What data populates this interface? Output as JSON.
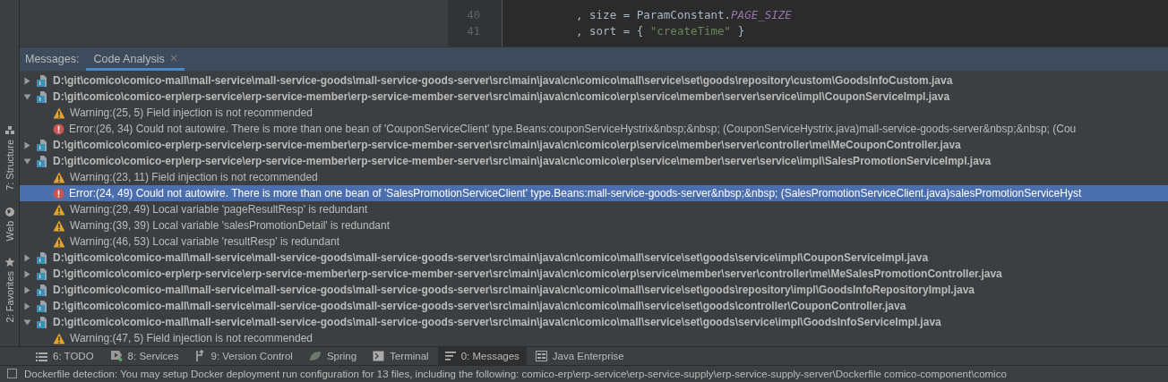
{
  "side_strip": [
    {
      "label": "7: Structure"
    },
    {
      "label": "Web"
    },
    {
      "label": "2: Favorites"
    }
  ],
  "editor": {
    "lines": [
      {
        "number": "40",
        "code": [
          {
            "kind": "plain",
            "text": ", size = ParamConstant."
          },
          {
            "kind": "constant",
            "text": "PAGE_SIZE"
          }
        ]
      },
      {
        "number": "41",
        "code": [
          {
            "kind": "plain",
            "text": ", sort = { "
          },
          {
            "kind": "string",
            "text": "\"createTime\""
          },
          {
            "kind": "plain",
            "text": " }"
          }
        ]
      }
    ]
  },
  "messages": {
    "label": "Messages:",
    "tabs": [
      {
        "label": "Code Analysis",
        "selected": true
      }
    ],
    "tree": [
      {
        "kind": "file",
        "text": "D:\\git\\comico\\comico-mall\\mall-service\\mall-service-goods\\mall-service-goods-server\\src\\main\\java\\cn\\comico\\mall\\service\\set\\goods\\repository\\custom\\GoodsInfoCustom.java",
        "expanded": false,
        "selected": false
      },
      {
        "kind": "file",
        "text": "D:\\git\\comico\\comico-erp\\erp-service\\erp-service-member\\erp-service-member-server\\src\\main\\java\\cn\\comico\\erp\\service\\member\\server\\service\\impl\\CouponServiceImpl.java",
        "expanded": true,
        "selected": false,
        "children": [
          {
            "kind": "warning",
            "text": "Warning:(25, 5)  Field injection is not recommended",
            "selected": false
          },
          {
            "kind": "error",
            "text": "Error:(26, 34)  Could not autowire. There is more than one bean of 'CouponServiceClient' type.Beans:couponServiceHystrix&nbsp;&nbsp; (CouponServiceHystrix.java)mall-service-goods-server&nbsp;&nbsp; (Cou",
            "selected": false
          }
        ]
      },
      {
        "kind": "file",
        "text": "D:\\git\\comico\\comico-erp\\erp-service\\erp-service-member\\erp-service-member-server\\src\\main\\java\\cn\\comico\\erp\\service\\member\\server\\controller\\me\\MeCouponController.java",
        "expanded": false,
        "selected": false
      },
      {
        "kind": "file",
        "text": "D:\\git\\comico\\comico-erp\\erp-service\\erp-service-member\\erp-service-member-server\\src\\main\\java\\cn\\comico\\erp\\service\\member\\server\\service\\impl\\SalesPromotionServiceImpl.java",
        "expanded": true,
        "selected": false,
        "children": [
          {
            "kind": "warning",
            "text": "Warning:(23, 11)  Field injection is not recommended",
            "selected": false
          },
          {
            "kind": "error",
            "text": "Error:(24, 49)  Could not autowire. There is more than one bean of 'SalesPromotionServiceClient' type.Beans:mall-service-goods-server&nbsp;&nbsp; (SalesPromotionServiceClient.java)salesPromotionServiceHyst",
            "selected": true
          },
          {
            "kind": "warning",
            "text": "Warning:(29, 49)  Local variable 'pageResultResp' is redundant",
            "selected": false
          },
          {
            "kind": "warning",
            "text": "Warning:(39, 39)  Local variable 'salesPromotionDetail' is redundant",
            "selected": false
          },
          {
            "kind": "warning",
            "text": "Warning:(46, 53)  Local variable 'resultResp' is redundant",
            "selected": false
          }
        ]
      },
      {
        "kind": "file",
        "text": "D:\\git\\comico\\comico-mall\\mall-service\\mall-service-goods\\mall-service-goods-server\\src\\main\\java\\cn\\comico\\mall\\service\\set\\goods\\service\\impl\\CouponServiceImpl.java",
        "expanded": false,
        "selected": false
      },
      {
        "kind": "file",
        "text": "D:\\git\\comico\\comico-erp\\erp-service\\erp-service-member\\erp-service-member-server\\src\\main\\java\\cn\\comico\\erp\\service\\member\\server\\controller\\me\\MeSalesPromotionController.java",
        "expanded": false,
        "selected": false
      },
      {
        "kind": "file",
        "text": "D:\\git\\comico\\comico-mall\\mall-service\\mall-service-goods\\mall-service-goods-server\\src\\main\\java\\cn\\comico\\mall\\service\\set\\goods\\repository\\impl\\GoodsInfoRepositoryImpl.java",
        "expanded": false,
        "selected": false
      },
      {
        "kind": "file",
        "text": "D:\\git\\comico\\comico-mall\\mall-service\\mall-service-goods\\mall-service-goods-server\\src\\main\\java\\cn\\comico\\mall\\service\\set\\goods\\controller\\CouponController.java",
        "expanded": false,
        "selected": false
      },
      {
        "kind": "file",
        "text": "D:\\git\\comico\\comico-mall\\mall-service\\mall-service-goods\\mall-service-goods-server\\src\\main\\java\\cn\\comico\\mall\\service\\set\\goods\\service\\impl\\GoodsInfoServiceImpl.java",
        "expanded": true,
        "selected": false,
        "children": [
          {
            "kind": "warning",
            "text": "Warning:(47, 5)  Field injection is not recommended",
            "selected": false
          }
        ]
      }
    ]
  },
  "tool_bar": [
    {
      "label": "6: TODO",
      "selected": false
    },
    {
      "label": "8: Services",
      "selected": false
    },
    {
      "label": "9: Version Control",
      "selected": false
    },
    {
      "label": "Spring",
      "selected": false
    },
    {
      "label": "Terminal",
      "selected": false
    },
    {
      "label": "0: Messages",
      "selected": true
    },
    {
      "label": "Java Enterprise",
      "selected": false
    }
  ],
  "status_bar": {
    "text": "Dockerfile detection: You may setup Docker deployment run configuration for 13 files, including the following: comico-erp\\erp-service\\erp-service-supply\\erp-service-supply-server\\Dockerfile comico-component\\comico"
  }
}
